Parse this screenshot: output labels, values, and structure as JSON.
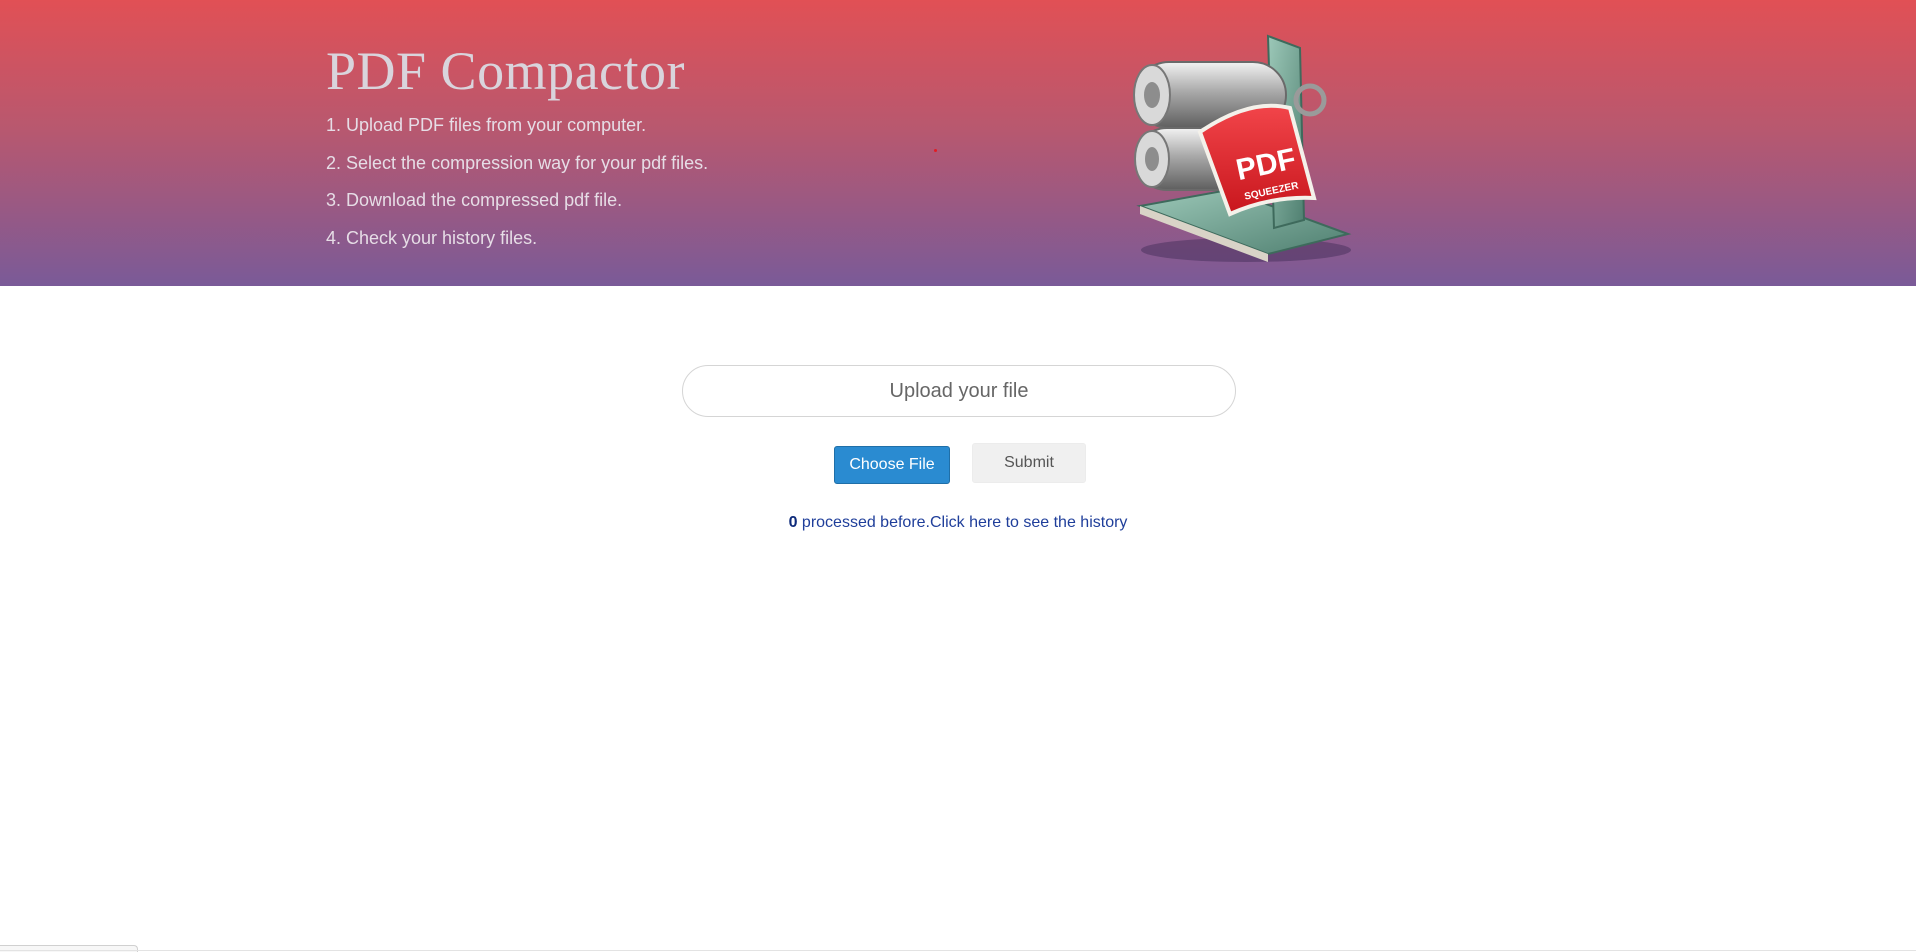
{
  "header": {
    "title": "PDF Compactor",
    "steps": [
      "1. Upload PDF files from your computer.",
      "2. Select the compression way for your pdf files.",
      "3. Download the compressed pdf file.",
      "4. Check your history files."
    ],
    "logo": {
      "icon": "pdf-squeezer-logo-icon",
      "label_main": "PDF",
      "label_sub": "SQUEEZER"
    }
  },
  "upload": {
    "box_label": "Upload your file",
    "choose_label": "Choose File",
    "submit_label": "Submit"
  },
  "history": {
    "count": "0",
    "text": " processed before.",
    "link_text": "Click here to see the history"
  },
  "colors": {
    "gradient_top": "#e15055",
    "gradient_bottom": "#7a5a98",
    "primary_button": "#2a8bd1",
    "link": "#1f3e9a"
  }
}
